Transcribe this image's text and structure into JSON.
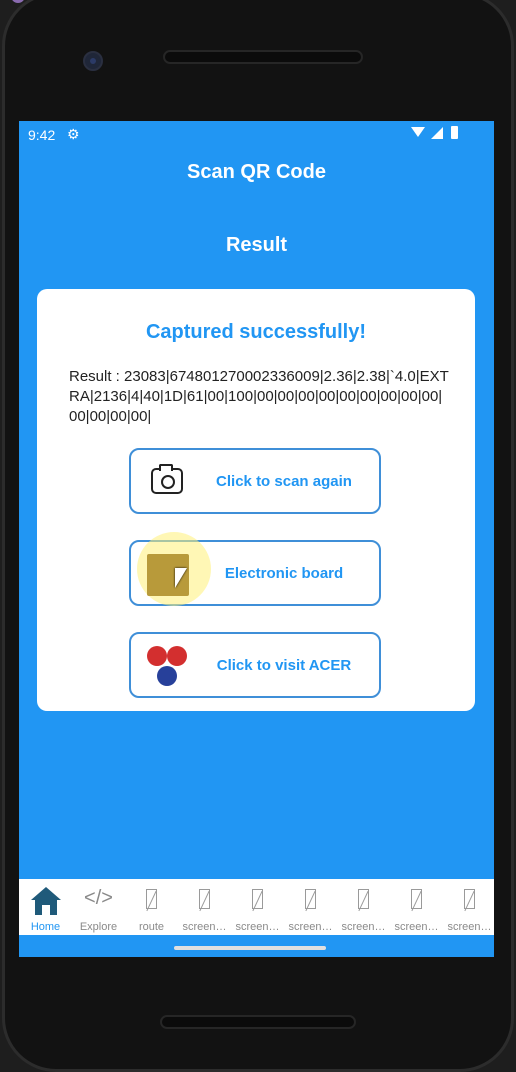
{
  "status_bar": {
    "time": "9:42"
  },
  "app_bar": {
    "title": "Scan QR Code"
  },
  "section": {
    "title": "Result"
  },
  "card": {
    "title": "Captured successfully!",
    "result_text": "Result : 23083|674801270002336009|2.36|2.38|`4.0|EXTRA|2136|4|40|1D|61|00|100|00|00|00|00|00|00|00|00|00|00|00|00|00|"
  },
  "buttons": {
    "scan_again": "Click to scan again",
    "board": "Electronic board",
    "acer": "Click to visit ACER"
  },
  "bottom_nav": {
    "items": [
      {
        "label": "Home",
        "icon": "home-icon",
        "active": true
      },
      {
        "label": "Explore",
        "icon": "code-icon"
      },
      {
        "label": "route",
        "icon": "broken-image-icon"
      },
      {
        "label": "screen…",
        "icon": "broken-image-icon"
      },
      {
        "label": "screen…",
        "icon": "broken-image-icon"
      },
      {
        "label": "screen…",
        "icon": "broken-image-icon"
      },
      {
        "label": "screen…",
        "icon": "broken-image-icon"
      },
      {
        "label": "screen…",
        "icon": "broken-image-icon"
      },
      {
        "label": "screen…",
        "icon": "broken-image-icon"
      }
    ]
  },
  "colors": {
    "primary": "#2196f3",
    "card": "#ffffff",
    "home_icon": "#1f5a7a"
  }
}
